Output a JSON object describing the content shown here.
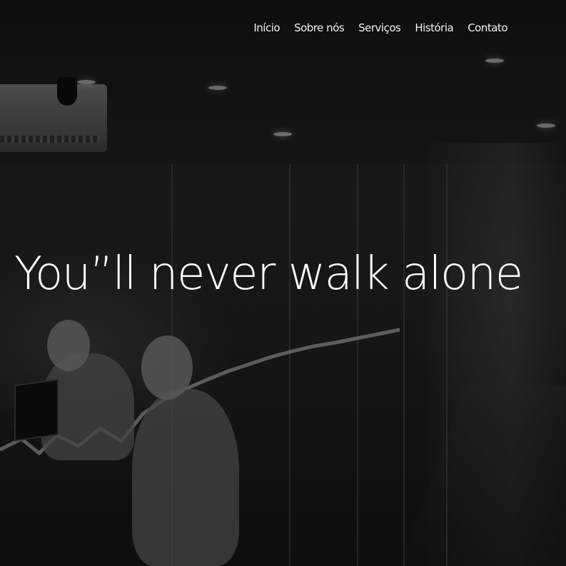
{
  "nav": {
    "items": [
      {
        "label": "Início"
      },
      {
        "label": "Sobre nós"
      },
      {
        "label": "Serviços"
      },
      {
        "label": "História"
      },
      {
        "label": "Contato"
      }
    ]
  },
  "hero": {
    "headline": "You”ll never walk alone",
    "background": "grayscale office photo with people working behind glass wall"
  },
  "colors": {
    "text": "#ffffff",
    "overlay": "#000000"
  }
}
